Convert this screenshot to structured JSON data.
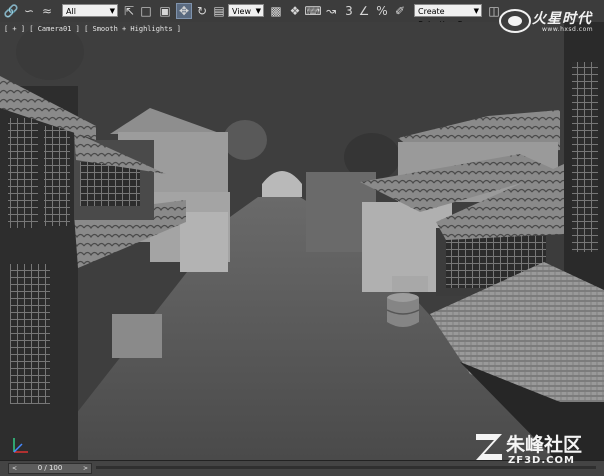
{
  "toolbar": {
    "selection_filter": "All",
    "reference_coordinate": "View",
    "named_selection_placeholder": "Create Selection Se",
    "snap_label": "3"
  },
  "viewport": {
    "label": "[ + ] [ Camera01 ] [ Smooth + Highlights ]"
  },
  "timeline": {
    "frame_display": "0 / 100"
  },
  "watermarks": {
    "top_right_title": "火星时代",
    "top_right_url": "www.hxsd.com",
    "bottom_right_cn": "朱峰社区",
    "bottom_right_en": "ZF3D.COM"
  },
  "icons": [
    "select-link-icon",
    "unlink-icon",
    "bind-space-warp-icon",
    "select-object-icon",
    "select-by-name-icon",
    "rectangular-selection-icon",
    "window-crossing-icon",
    "select-and-move-icon",
    "select-and-rotate-icon",
    "select-and-scale-icon",
    "use-pivot-center-icon",
    "select-and-manipulate-icon",
    "keyboard-shortcut-icon",
    "snaps-toggle-icon",
    "angle-snap-icon",
    "percent-snap-icon",
    "spinner-snap-icon",
    "edit-named-selection-icon",
    "mirror-icon"
  ]
}
